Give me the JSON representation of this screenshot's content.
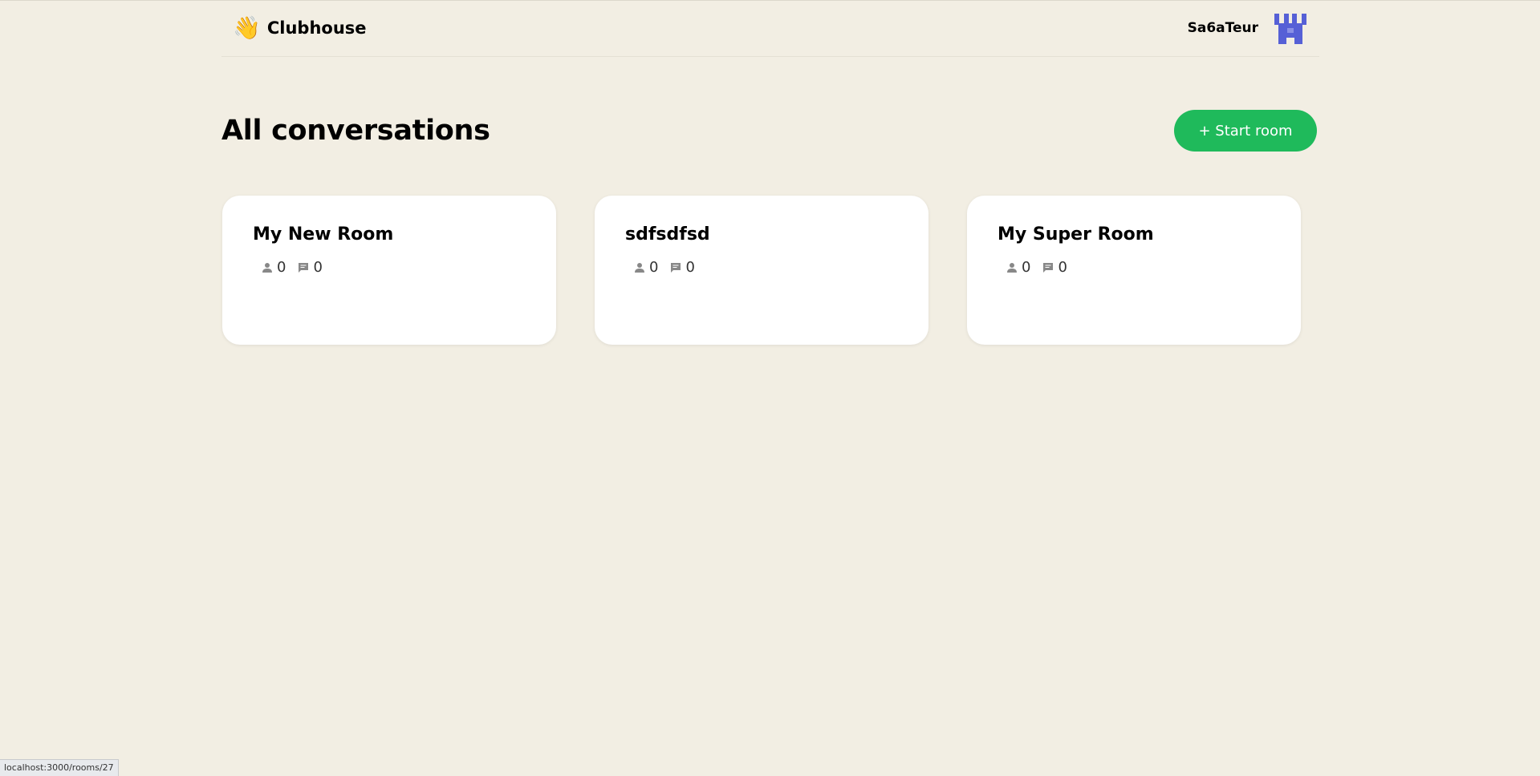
{
  "header": {
    "logo_icon": "👋",
    "logo_text": "Clubhouse",
    "username": "Sa6aTeur",
    "avatar_color": "#5660d6"
  },
  "main": {
    "title": "All conversations",
    "start_room_label": "+ Start room",
    "accent_color": "#1fba5b"
  },
  "rooms": [
    {
      "title": "My New Room",
      "listeners": "0",
      "messages": "0"
    },
    {
      "title": "sdfsdfsd",
      "listeners": "0",
      "messages": "0"
    },
    {
      "title": "My Super Room",
      "listeners": "0",
      "messages": "0"
    }
  ],
  "icons": {
    "listeners": "user-icon",
    "messages": "chat-bubble-icon"
  },
  "status_bar": {
    "url": "localhost:3000/rooms/27"
  }
}
